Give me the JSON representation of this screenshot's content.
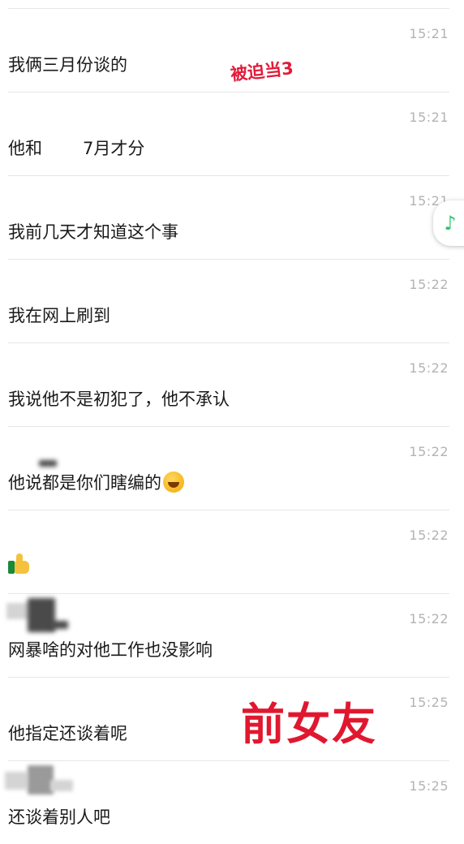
{
  "messages": [
    {
      "time": "15:21",
      "text": "我俩三月份谈的"
    },
    {
      "time": "15:21",
      "text_a": "他和",
      "text_b": "7月才分"
    },
    {
      "time": "15:21",
      "text": "我前几天才知道这个事"
    },
    {
      "time": "15:22",
      "text": "我在网上刷到"
    },
    {
      "time": "15:22",
      "text": "我说他不是初犯了，他不承认"
    },
    {
      "time": "15:22",
      "text": "他说都是你们瞎编的"
    },
    {
      "time": "15:22",
      "text": ""
    },
    {
      "time": "15:22",
      "text_a": "网暴啥的对",
      "text_b": "他工作也没影响"
    },
    {
      "time": "15:25",
      "text": "他指定还谈着呢"
    },
    {
      "time": "15:25",
      "text": "还谈着别人吧"
    }
  ],
  "overlays": {
    "small_caption": "被迫当3",
    "big_caption": "前女友"
  },
  "icons": {
    "laugh_emoji": "laughing-crying-emoji",
    "thumbs_up_emoji": "thumbs-up-emoji",
    "music_note": "music-note-icon"
  },
  "colors": {
    "overlay_red": "#e0182f",
    "timestamp_gray": "#b3b3b3",
    "music_green": "#2ec56b"
  }
}
